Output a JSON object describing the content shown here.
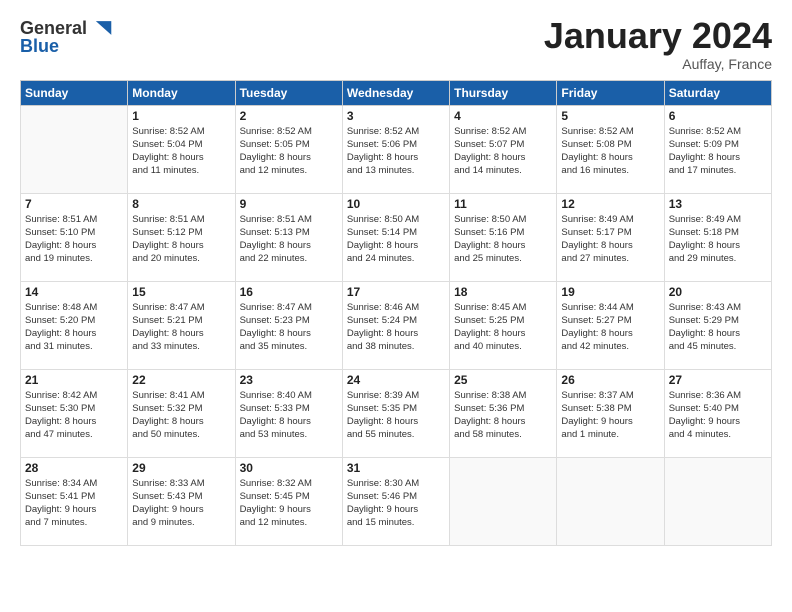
{
  "header": {
    "logo_general": "General",
    "logo_blue": "Blue",
    "month_title": "January 2024",
    "location": "Auffay, France"
  },
  "days_of_week": [
    "Sunday",
    "Monday",
    "Tuesday",
    "Wednesday",
    "Thursday",
    "Friday",
    "Saturday"
  ],
  "weeks": [
    [
      {
        "day": "",
        "info": ""
      },
      {
        "day": "1",
        "info": "Sunrise: 8:52 AM\nSunset: 5:04 PM\nDaylight: 8 hours\nand 11 minutes."
      },
      {
        "day": "2",
        "info": "Sunrise: 8:52 AM\nSunset: 5:05 PM\nDaylight: 8 hours\nand 12 minutes."
      },
      {
        "day": "3",
        "info": "Sunrise: 8:52 AM\nSunset: 5:06 PM\nDaylight: 8 hours\nand 13 minutes."
      },
      {
        "day": "4",
        "info": "Sunrise: 8:52 AM\nSunset: 5:07 PM\nDaylight: 8 hours\nand 14 minutes."
      },
      {
        "day": "5",
        "info": "Sunrise: 8:52 AM\nSunset: 5:08 PM\nDaylight: 8 hours\nand 16 minutes."
      },
      {
        "day": "6",
        "info": "Sunrise: 8:52 AM\nSunset: 5:09 PM\nDaylight: 8 hours\nand 17 minutes."
      }
    ],
    [
      {
        "day": "7",
        "info": "Sunrise: 8:51 AM\nSunset: 5:10 PM\nDaylight: 8 hours\nand 19 minutes."
      },
      {
        "day": "8",
        "info": "Sunrise: 8:51 AM\nSunset: 5:12 PM\nDaylight: 8 hours\nand 20 minutes."
      },
      {
        "day": "9",
        "info": "Sunrise: 8:51 AM\nSunset: 5:13 PM\nDaylight: 8 hours\nand 22 minutes."
      },
      {
        "day": "10",
        "info": "Sunrise: 8:50 AM\nSunset: 5:14 PM\nDaylight: 8 hours\nand 24 minutes."
      },
      {
        "day": "11",
        "info": "Sunrise: 8:50 AM\nSunset: 5:16 PM\nDaylight: 8 hours\nand 25 minutes."
      },
      {
        "day": "12",
        "info": "Sunrise: 8:49 AM\nSunset: 5:17 PM\nDaylight: 8 hours\nand 27 minutes."
      },
      {
        "day": "13",
        "info": "Sunrise: 8:49 AM\nSunset: 5:18 PM\nDaylight: 8 hours\nand 29 minutes."
      }
    ],
    [
      {
        "day": "14",
        "info": "Sunrise: 8:48 AM\nSunset: 5:20 PM\nDaylight: 8 hours\nand 31 minutes."
      },
      {
        "day": "15",
        "info": "Sunrise: 8:47 AM\nSunset: 5:21 PM\nDaylight: 8 hours\nand 33 minutes."
      },
      {
        "day": "16",
        "info": "Sunrise: 8:47 AM\nSunset: 5:23 PM\nDaylight: 8 hours\nand 35 minutes."
      },
      {
        "day": "17",
        "info": "Sunrise: 8:46 AM\nSunset: 5:24 PM\nDaylight: 8 hours\nand 38 minutes."
      },
      {
        "day": "18",
        "info": "Sunrise: 8:45 AM\nSunset: 5:25 PM\nDaylight: 8 hours\nand 40 minutes."
      },
      {
        "day": "19",
        "info": "Sunrise: 8:44 AM\nSunset: 5:27 PM\nDaylight: 8 hours\nand 42 minutes."
      },
      {
        "day": "20",
        "info": "Sunrise: 8:43 AM\nSunset: 5:29 PM\nDaylight: 8 hours\nand 45 minutes."
      }
    ],
    [
      {
        "day": "21",
        "info": "Sunrise: 8:42 AM\nSunset: 5:30 PM\nDaylight: 8 hours\nand 47 minutes."
      },
      {
        "day": "22",
        "info": "Sunrise: 8:41 AM\nSunset: 5:32 PM\nDaylight: 8 hours\nand 50 minutes."
      },
      {
        "day": "23",
        "info": "Sunrise: 8:40 AM\nSunset: 5:33 PM\nDaylight: 8 hours\nand 53 minutes."
      },
      {
        "day": "24",
        "info": "Sunrise: 8:39 AM\nSunset: 5:35 PM\nDaylight: 8 hours\nand 55 minutes."
      },
      {
        "day": "25",
        "info": "Sunrise: 8:38 AM\nSunset: 5:36 PM\nDaylight: 8 hours\nand 58 minutes."
      },
      {
        "day": "26",
        "info": "Sunrise: 8:37 AM\nSunset: 5:38 PM\nDaylight: 9 hours\nand 1 minute."
      },
      {
        "day": "27",
        "info": "Sunrise: 8:36 AM\nSunset: 5:40 PM\nDaylight: 9 hours\nand 4 minutes."
      }
    ],
    [
      {
        "day": "28",
        "info": "Sunrise: 8:34 AM\nSunset: 5:41 PM\nDaylight: 9 hours\nand 7 minutes."
      },
      {
        "day": "29",
        "info": "Sunrise: 8:33 AM\nSunset: 5:43 PM\nDaylight: 9 hours\nand 9 minutes."
      },
      {
        "day": "30",
        "info": "Sunrise: 8:32 AM\nSunset: 5:45 PM\nDaylight: 9 hours\nand 12 minutes."
      },
      {
        "day": "31",
        "info": "Sunrise: 8:30 AM\nSunset: 5:46 PM\nDaylight: 9 hours\nand 15 minutes."
      },
      {
        "day": "",
        "info": ""
      },
      {
        "day": "",
        "info": ""
      },
      {
        "day": "",
        "info": ""
      }
    ]
  ]
}
